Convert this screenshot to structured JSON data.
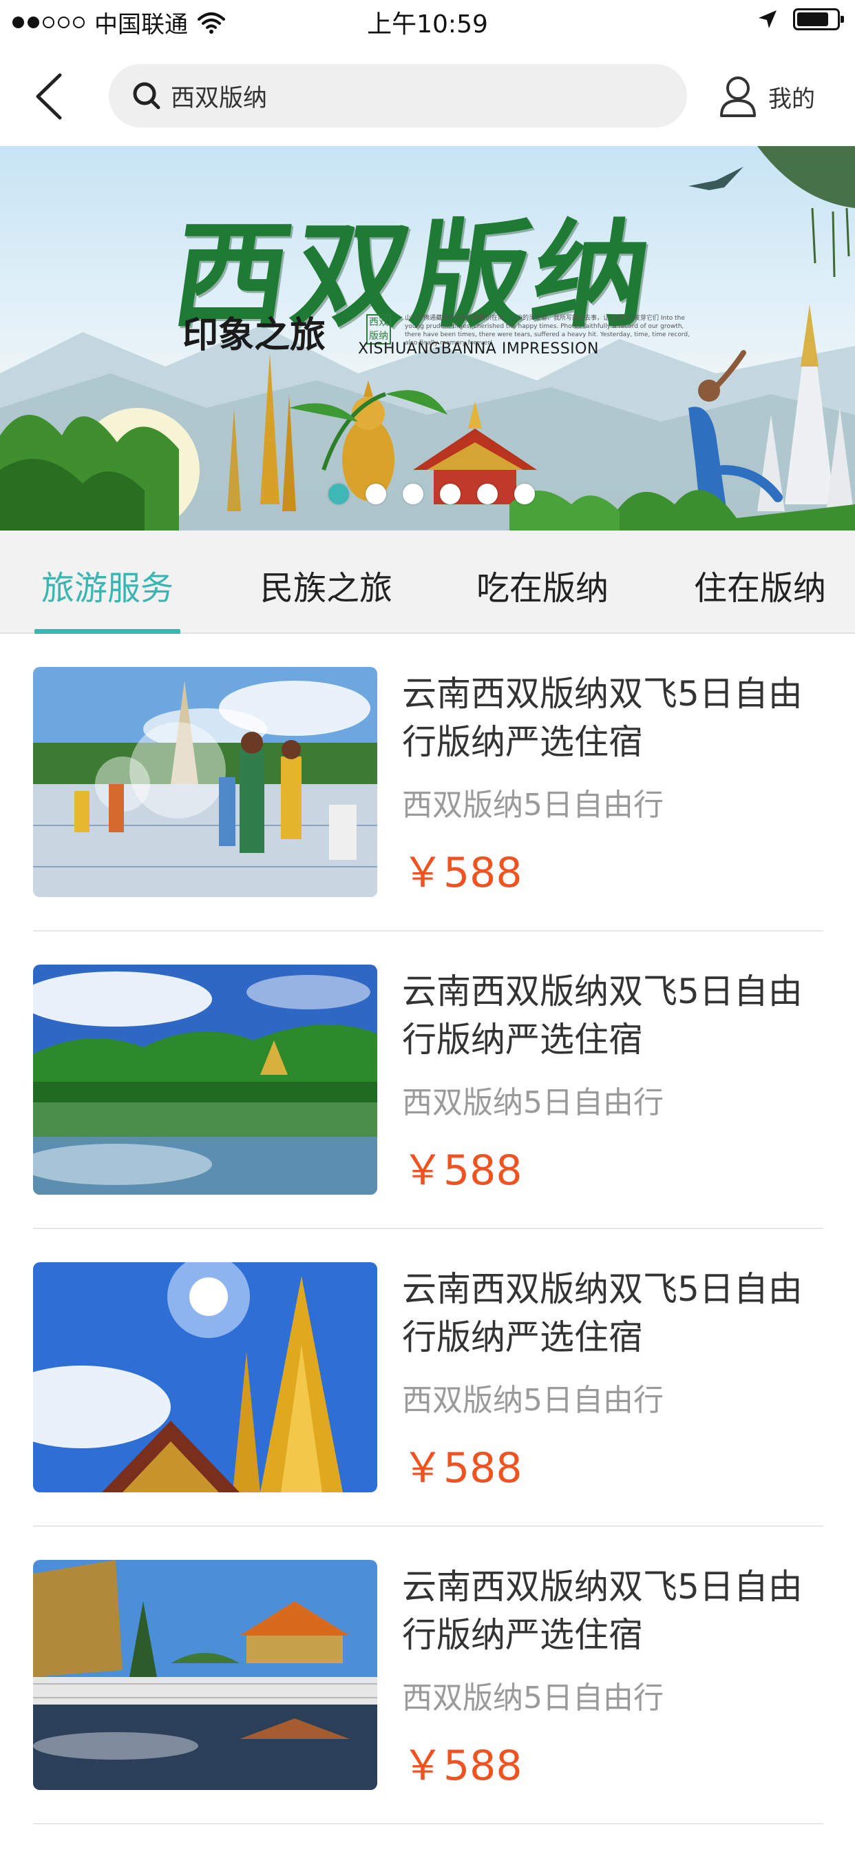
{
  "status_bar": {
    "carrier": "中国联通",
    "time": "上午10:59"
  },
  "header": {
    "search_value": "西双版纳",
    "profile_label": "我的"
  },
  "banner": {
    "title": "西双版纳",
    "subtitle": "印象之旅",
    "seal_text": "西双版纳",
    "english": "XISHUANGBANNA IMPRESSION",
    "blurb": "山下华佛通藏绿翠于我们的相识在南，相约的灵证者、我所写的过去事，让这我们的发芽它们 Into the young prudent times, cherished the happy times. Photos faithfully a record of our growth, there have been times, there were tears, suffered a heavy hit. Yesterday, time, time record, also finally memory forever!",
    "page_count": 6,
    "active_page": 1
  },
  "tabs": [
    {
      "label": "旅游服务",
      "active": true
    },
    {
      "label": "民族之旅",
      "active": false
    },
    {
      "label": "吃在版纳",
      "active": false
    },
    {
      "label": "住在版纳",
      "active": false
    }
  ],
  "products": [
    {
      "title": "云南西双版纳双飞5日自由行版纳严选住宿",
      "subtitle": "西双版纳5日自由行",
      "price": "￥588",
      "image": "water-splashing-festival"
    },
    {
      "title": "云南西双版纳双飞5日自由行版纳严选住宿",
      "subtitle": "西双版纳5日自由行",
      "price": "￥588",
      "image": "lake-forest-landscape"
    },
    {
      "title": "云南西双版纳双飞5日自由行版纳严选住宿",
      "subtitle": "西双版纳5日自由行",
      "price": "￥588",
      "image": "golden-pagoda-sun"
    },
    {
      "title": "云南西双版纳双飞5日自由行版纳严选住宿",
      "subtitle": "西双版纳5日自由行",
      "price": "￥588",
      "image": "temple-reflection-pool"
    }
  ],
  "colors": {
    "accent": "#3ab5b2",
    "price": "#f0531f",
    "subtitle": "#9a9a9a",
    "tab_bar_bg": "#f2f2f2"
  },
  "icons": [
    "back-arrow-icon",
    "search-icon",
    "user-icon",
    "wifi-icon",
    "location-arrow-icon",
    "battery-icon"
  ]
}
